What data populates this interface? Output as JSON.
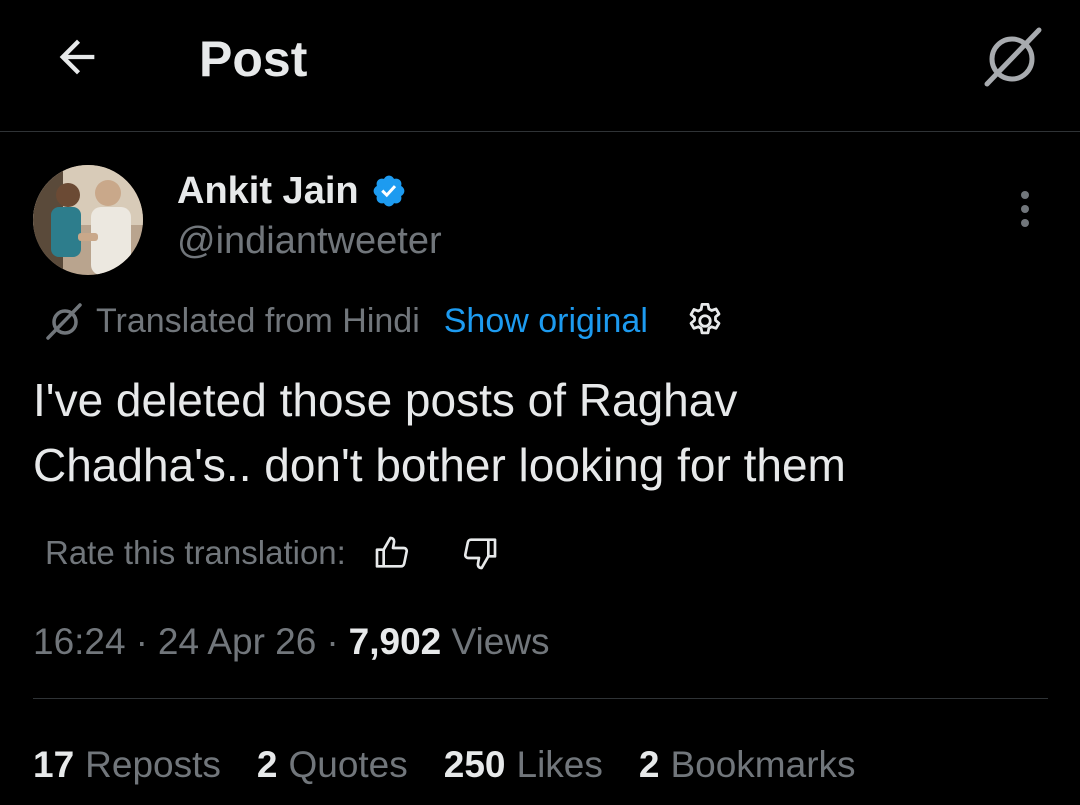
{
  "header": {
    "title": "Post"
  },
  "author": {
    "name": "Ankit Jain",
    "handle": "@indiantweeter"
  },
  "translation": {
    "label": "Translated from Hindi",
    "show_original": "Show original"
  },
  "post": {
    "text_lines": [
      "I've deleted those posts of Raghav",
      "Chadha's.. don't bother looking for them"
    ]
  },
  "rate": {
    "label": "Rate this translation:"
  },
  "meta": {
    "time": "16:24",
    "separator": "·",
    "date": "24 Apr 26",
    "views_count": "7,902",
    "views_label": "Views"
  },
  "stats": {
    "reposts_count": "17",
    "reposts_label": "Reposts",
    "quotes_count": "2",
    "quotes_label": "Quotes",
    "likes_count": "250",
    "likes_label": "Likes",
    "bookmarks_count": "2",
    "bookmarks_label": "Bookmarks"
  },
  "colors": {
    "background": "#000000",
    "text_primary": "#e7e9ea",
    "text_secondary": "#71767b",
    "accent": "#1d9bf0",
    "divider": "#2f3336"
  },
  "icons": {
    "back": "arrow-left-icon",
    "grok": "grok-icon",
    "verified": "verified-badge-icon",
    "more": "more-vertical-icon",
    "translate": "translate-icon",
    "settings": "gear-icon",
    "thumbs_up": "thumbs-up-icon",
    "thumbs_down": "thumbs-down-icon"
  }
}
